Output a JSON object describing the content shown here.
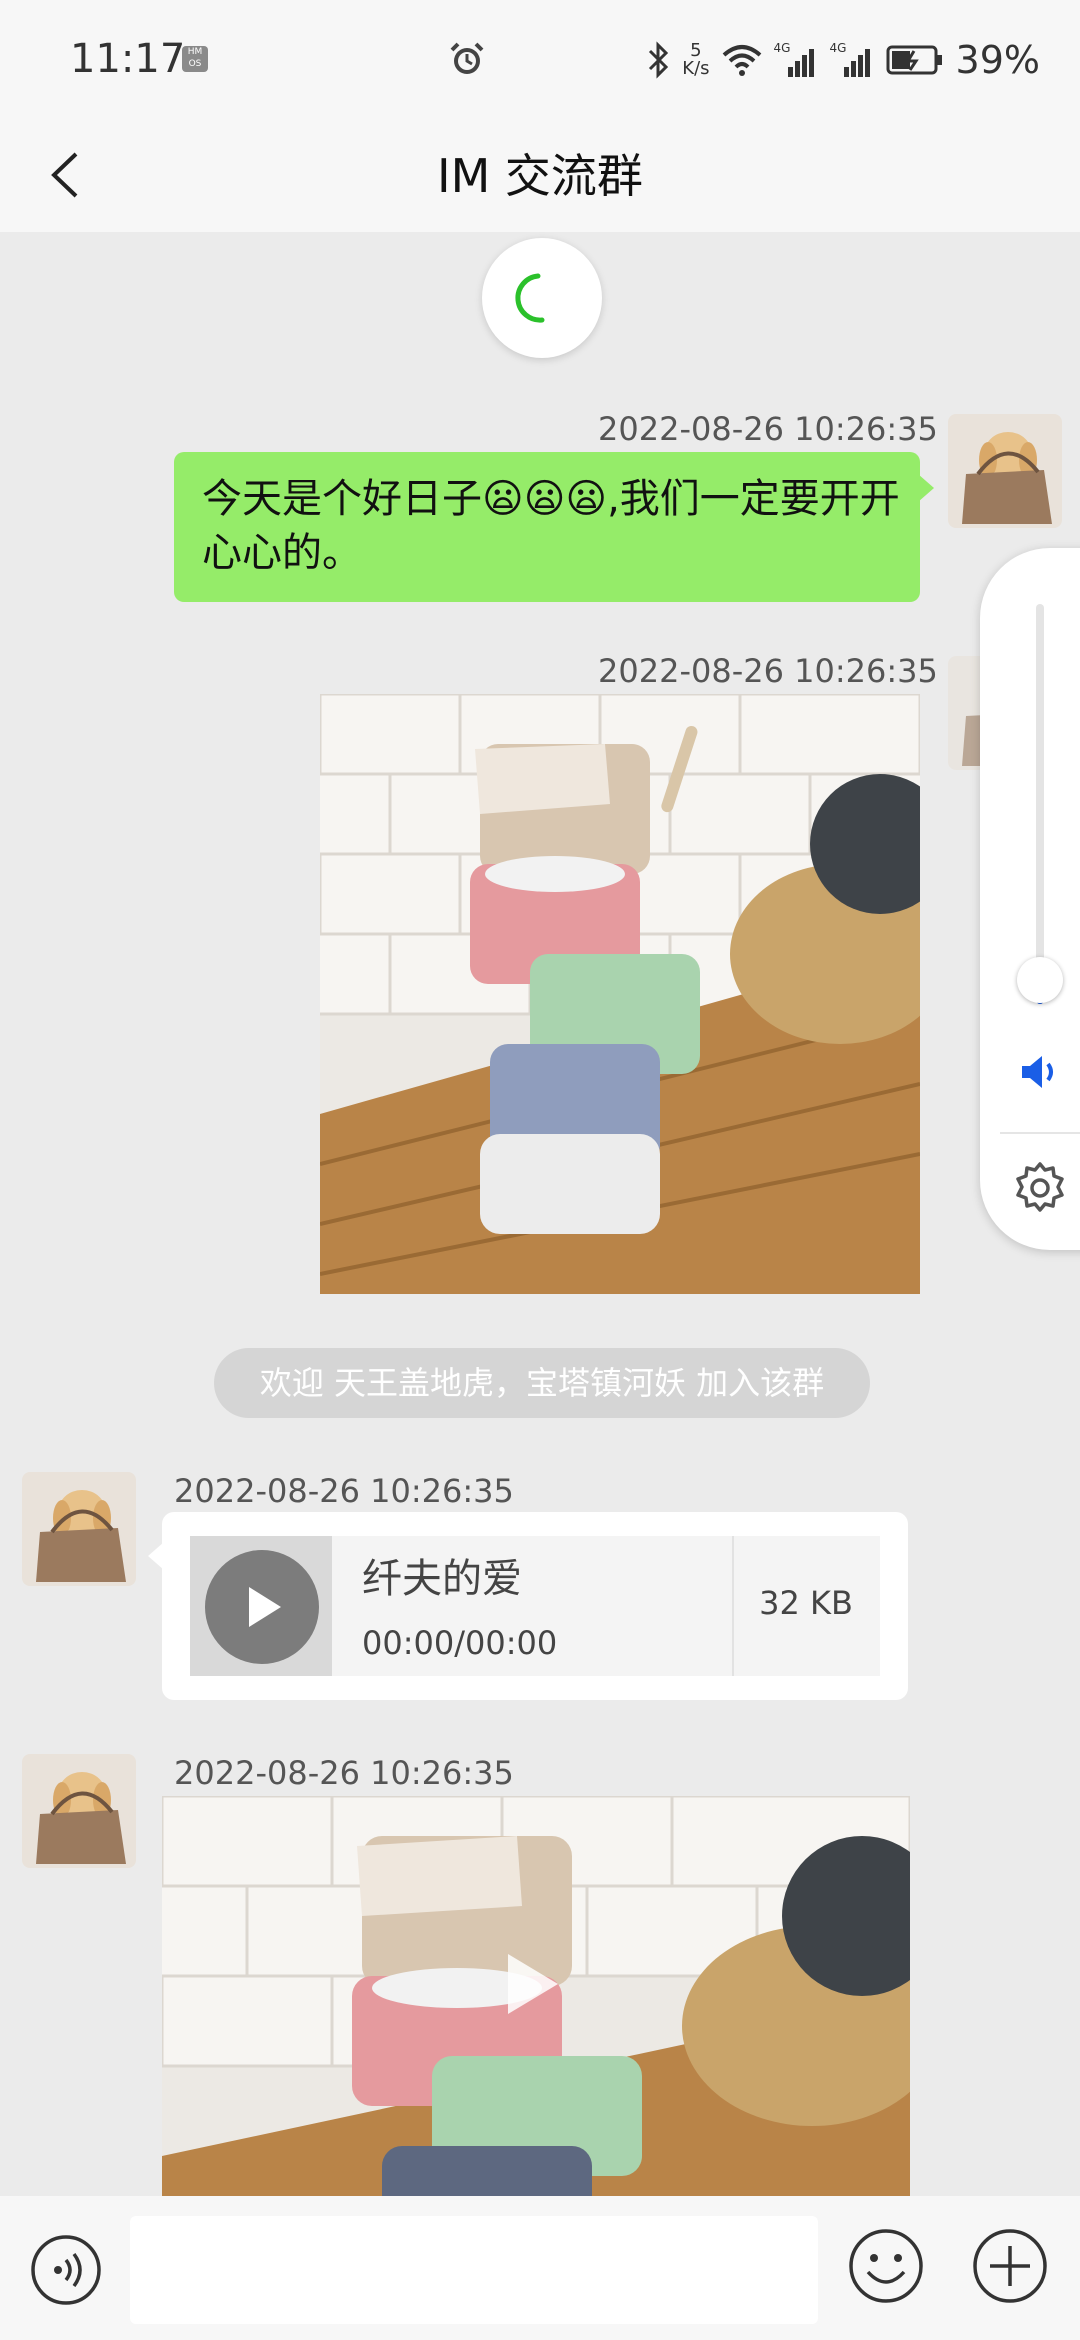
{
  "status_bar": {
    "time": "11:17",
    "network_speed_value": "5",
    "network_speed_unit": "K/s",
    "net_type_1": "4G",
    "net_type_2": "4G",
    "battery": "39%"
  },
  "header": {
    "title": "IM 交流群"
  },
  "messages": [
    {
      "type": "text",
      "side": "right",
      "timestamp": "2022-08-26 10:26:35",
      "text": "今天是个好日子😦😦😦,我们一定要开开心心的。"
    },
    {
      "type": "image",
      "side": "right",
      "timestamp": "2022-08-26 10:26:35"
    },
    {
      "type": "system",
      "text": "欢迎 天王盖地虎，宝塔镇河妖 加入该群"
    },
    {
      "type": "audio",
      "side": "left",
      "timestamp": "2022-08-26 10:26:35",
      "title": "纤夫的爱",
      "time": "00:00/00:00",
      "size": "32 KB"
    },
    {
      "type": "video",
      "side": "left",
      "timestamp": "2022-08-26 10:26:35"
    }
  ],
  "volume_panel": {
    "level": 0.06
  },
  "input_bar": {
    "placeholder": ""
  },
  "colors": {
    "my_bubble": "#95ec69",
    "accent_blue": "#1a5ee6",
    "page_bg": "#ebebeb"
  },
  "icons": [
    "hmos-icon",
    "alarm-icon",
    "bluetooth-icon",
    "wifi-icon",
    "signal-icon",
    "battery-icon",
    "back-icon",
    "refresh-spinner-icon",
    "play-icon",
    "volume-icon",
    "settings-icon",
    "voice-icon",
    "emoji-icon",
    "plus-icon"
  ]
}
